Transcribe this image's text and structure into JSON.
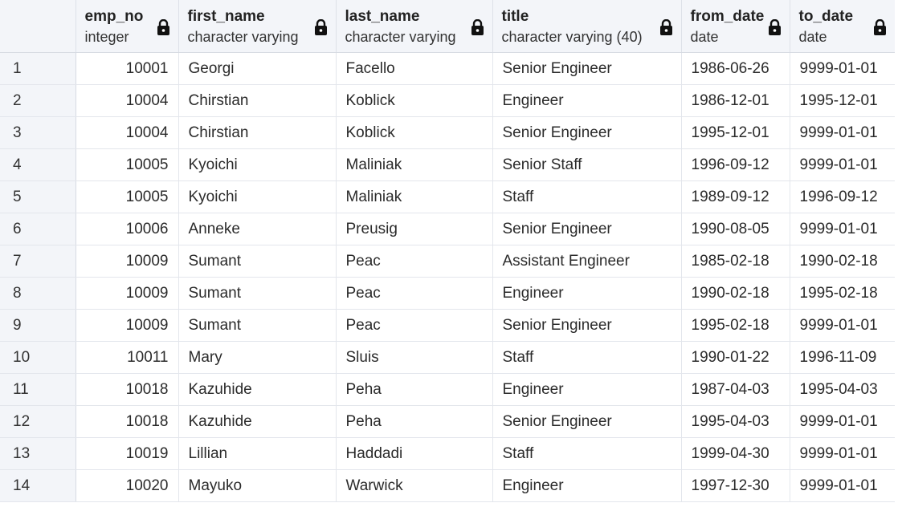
{
  "grid": {
    "columns": [
      {
        "name": "emp_no",
        "type": "integer"
      },
      {
        "name": "first_name",
        "type": "character varying"
      },
      {
        "name": "last_name",
        "type": "character varying"
      },
      {
        "name": "title",
        "type": "character varying (40)"
      },
      {
        "name": "from_date",
        "type": "date"
      },
      {
        "name": "to_date",
        "type": "date"
      }
    ],
    "rows": [
      {
        "n": "1",
        "emp_no": "10001",
        "first_name": "Georgi",
        "last_name": "Facello",
        "title": "Senior Engineer",
        "from_date": "1986-06-26",
        "to_date": "9999-01-01"
      },
      {
        "n": "2",
        "emp_no": "10004",
        "first_name": "Chirstian",
        "last_name": "Koblick",
        "title": "Engineer",
        "from_date": "1986-12-01",
        "to_date": "1995-12-01"
      },
      {
        "n": "3",
        "emp_no": "10004",
        "first_name": "Chirstian",
        "last_name": "Koblick",
        "title": "Senior Engineer",
        "from_date": "1995-12-01",
        "to_date": "9999-01-01"
      },
      {
        "n": "4",
        "emp_no": "10005",
        "first_name": "Kyoichi",
        "last_name": "Maliniak",
        "title": "Senior Staff",
        "from_date": "1996-09-12",
        "to_date": "9999-01-01"
      },
      {
        "n": "5",
        "emp_no": "10005",
        "first_name": "Kyoichi",
        "last_name": "Maliniak",
        "title": "Staff",
        "from_date": "1989-09-12",
        "to_date": "1996-09-12"
      },
      {
        "n": "6",
        "emp_no": "10006",
        "first_name": "Anneke",
        "last_name": "Preusig",
        "title": "Senior Engineer",
        "from_date": "1990-08-05",
        "to_date": "9999-01-01"
      },
      {
        "n": "7",
        "emp_no": "10009",
        "first_name": "Sumant",
        "last_name": "Peac",
        "title": "Assistant Engineer",
        "from_date": "1985-02-18",
        "to_date": "1990-02-18"
      },
      {
        "n": "8",
        "emp_no": "10009",
        "first_name": "Sumant",
        "last_name": "Peac",
        "title": "Engineer",
        "from_date": "1990-02-18",
        "to_date": "1995-02-18"
      },
      {
        "n": "9",
        "emp_no": "10009",
        "first_name": "Sumant",
        "last_name": "Peac",
        "title": "Senior Engineer",
        "from_date": "1995-02-18",
        "to_date": "9999-01-01"
      },
      {
        "n": "10",
        "emp_no": "10011",
        "first_name": "Mary",
        "last_name": "Sluis",
        "title": "Staff",
        "from_date": "1990-01-22",
        "to_date": "1996-11-09"
      },
      {
        "n": "11",
        "emp_no": "10018",
        "first_name": "Kazuhide",
        "last_name": "Peha",
        "title": "Engineer",
        "from_date": "1987-04-03",
        "to_date": "1995-04-03"
      },
      {
        "n": "12",
        "emp_no": "10018",
        "first_name": "Kazuhide",
        "last_name": "Peha",
        "title": "Senior Engineer",
        "from_date": "1995-04-03",
        "to_date": "9999-01-01"
      },
      {
        "n": "13",
        "emp_no": "10019",
        "first_name": "Lillian",
        "last_name": "Haddadi",
        "title": "Staff",
        "from_date": "1999-04-30",
        "to_date": "9999-01-01"
      },
      {
        "n": "14",
        "emp_no": "10020",
        "first_name": "Mayuko",
        "last_name": "Warwick",
        "title": "Engineer",
        "from_date": "1997-12-30",
        "to_date": "9999-01-01"
      }
    ]
  },
  "icons": {
    "column_lock": "lock-icon"
  },
  "colors": {
    "header_bg": "#f3f5f9",
    "grid_line": "#e3e6ec",
    "text": "#2b2b2b"
  }
}
